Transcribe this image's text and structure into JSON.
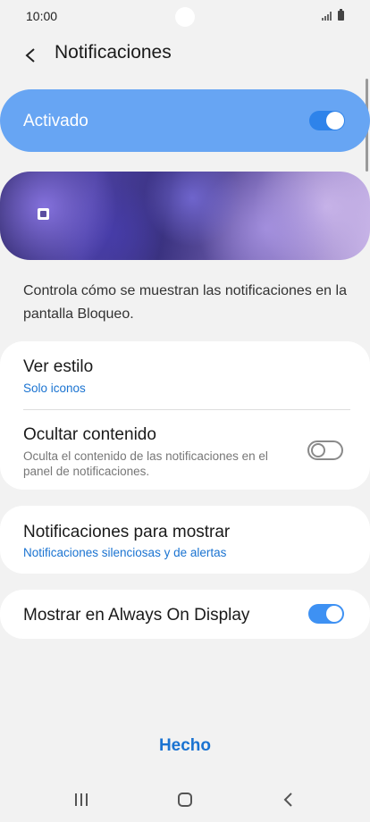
{
  "status_bar": {
    "time": "10:00"
  },
  "header": {
    "title": "Notificaciones"
  },
  "master_toggle": {
    "label": "Activado",
    "state": "on"
  },
  "description": "Controla cómo se muestran las notificaciones en la pantalla Bloqueo.",
  "settings": {
    "view_style": {
      "title": "Ver estilo",
      "value": "Solo iconos"
    },
    "hide_content": {
      "title": "Ocultar contenido",
      "description": "Oculta el contenido de las notificaciones en el panel de notificaciones.",
      "state": "off"
    },
    "notifications_to_show": {
      "title": "Notificaciones para mostrar",
      "value": "Notificaciones silenciosas y de alertas"
    },
    "always_on_display": {
      "title": "Mostrar en Always On Display",
      "state": "on"
    }
  },
  "done_button": {
    "label": "Hecho"
  },
  "colors": {
    "accent": "#1a73d1",
    "master_bg": "#67a5f3",
    "background": "#f2f2f2"
  },
  "icons": [
    "back-arrow-icon",
    "signal-icon",
    "battery-icon",
    "lock-icon",
    "recent-apps-icon",
    "home-icon",
    "nav-back-icon"
  ]
}
